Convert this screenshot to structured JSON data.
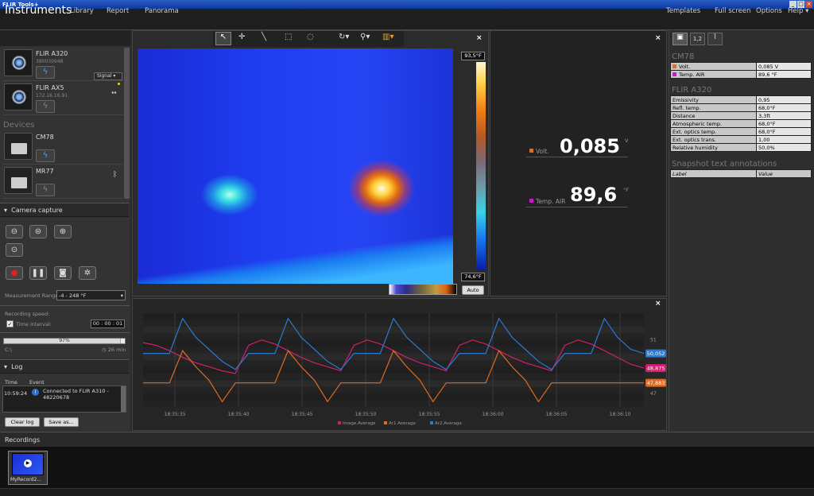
{
  "titlebar": {
    "title": "FLIR Tools+"
  },
  "menubar": {
    "app_name": "Instruments",
    "items": [
      "Library",
      "Report",
      "Panorama"
    ],
    "right_items": [
      "Templates",
      "Full screen",
      "Options",
      "Help ▾"
    ]
  },
  "cameras": [
    {
      "name": "FLIR A320",
      "id": "380030948",
      "mode": "Signal",
      "status": "connected"
    },
    {
      "name": "FLIR AX5",
      "id": "172.16.16.91",
      "status": "disconnected"
    }
  ],
  "devices": {
    "heading": "Devices",
    "items": [
      {
        "name": "CM78",
        "status": "connected"
      },
      {
        "name": "MR77",
        "status": "disconnected"
      }
    ]
  },
  "capture": {
    "heading": "Camera capture",
    "range_label": "Measurement Range:",
    "range_value": "-4 - 248 °F",
    "speed_heading": "Recording speed:",
    "interval_label": "Time interval:",
    "interval_value": "00 : 00 : 01",
    "progress": 0.97,
    "progress_label": "97%",
    "drive": "C:\\",
    "time_left": "26 min"
  },
  "log": {
    "heading": "Log",
    "col_time": "Time",
    "col_event": "Event",
    "entries": [
      {
        "time": "10:59:24",
        "event": "Connected to FLIR A310 - 48220678"
      }
    ],
    "clear_btn": "Clear log",
    "save_btn": "Save as..."
  },
  "image": {
    "max_temp": "93,5°F",
    "min_temp": "74,6°F",
    "auto_btn": "Auto"
  },
  "values": [
    {
      "name": "Volt.",
      "value": "0,085",
      "unit": "V",
      "color": "#e07020"
    },
    {
      "name": "Temp. AIR",
      "value": "89,6",
      "unit": "°F",
      "color": "#c020c0"
    }
  ],
  "props": {
    "cm78_heading": "CM78",
    "cm78_rows": [
      {
        "label": "Volt.",
        "value": "0,085  V",
        "color": "#e07020"
      },
      {
        "label": "Temp. AIR",
        "value": "89,6  °F",
        "color": "#c020c0"
      }
    ],
    "a320_heading": "FLIR A320",
    "a320_rows": [
      {
        "label": "Emissivity",
        "value": "0,95"
      },
      {
        "label": "Refl. temp.",
        "value": "68,0°F"
      },
      {
        "label": "Distance",
        "value": "3,3ft"
      },
      {
        "label": "Atmospheric temp.",
        "value": "68,0°F"
      },
      {
        "label": "Ext. optics temp.",
        "value": "68,0°F"
      },
      {
        "label": "Ext. optics trans.",
        "value": "1,00"
      },
      {
        "label": "Relative humidity",
        "value": "50,0%"
      }
    ],
    "snapshot_heading": "Snapshot text annotations",
    "snapshot_cols": {
      "label": "Label",
      "value": "Value"
    }
  },
  "chart_data": {
    "type": "line",
    "x_ticks": [
      "18:35:35",
      "18:35:40",
      "18:35:45",
      "18:35:50",
      "18:35:55",
      "18:36:00",
      "18:36:05",
      "18:36:10"
    ],
    "y_ticks": [
      "51",
      "47"
    ],
    "y_range": [
      46,
      53
    ],
    "series": [
      {
        "name": "Image.Average",
        "color": "#d0206e",
        "current_value": "48,875",
        "values": [
          50.8,
          50.6,
          50.2,
          49.7,
          49.3,
          49.0,
          48.7,
          48.5,
          50.6,
          51.0,
          50.7,
          50.2,
          49.7,
          49.3,
          49.0,
          48.7,
          50.6,
          51.0,
          50.7,
          50.2,
          49.7,
          49.3,
          49.0,
          48.7,
          50.6,
          51.0,
          50.7,
          50.2,
          49.7,
          49.3,
          49.0,
          48.7,
          50.6,
          51.0,
          50.7,
          50.2,
          49.7,
          49.2,
          48.9
        ]
      },
      {
        "name": "Ar1.Average",
        "color": "#e06a20",
        "current_value": "47,883",
        "values": [
          47.8,
          47.8,
          47.8,
          50.2,
          49.0,
          48.0,
          46.4,
          47.8,
          47.8,
          47.8,
          47.8,
          50.2,
          49.0,
          48.0,
          46.4,
          47.8,
          47.8,
          47.8,
          47.8,
          50.2,
          49.0,
          48.0,
          46.4,
          47.8,
          47.8,
          47.8,
          47.8,
          50.2,
          49.0,
          48.0,
          46.4,
          47.8,
          47.8,
          47.8,
          47.8,
          47.8,
          47.8,
          47.8,
          47.8
        ]
      },
      {
        "name": "Ar2.Average",
        "color": "#2a7ad0",
        "current_value": "50,052",
        "values": [
          50.0,
          50.0,
          50.0,
          52.6,
          51.2,
          50.3,
          49.4,
          48.8,
          50.0,
          50.0,
          50.0,
          52.6,
          51.2,
          50.3,
          49.4,
          48.8,
          50.0,
          50.0,
          50.0,
          52.6,
          51.2,
          50.3,
          49.4,
          48.8,
          50.0,
          50.0,
          50.0,
          52.6,
          51.2,
          50.3,
          49.4,
          48.8,
          50.0,
          50.0,
          50.0,
          52.6,
          51.2,
          50.3,
          50.0
        ]
      }
    ]
  },
  "recordings": {
    "heading": "Recordings",
    "items": [
      {
        "name": "MyRecord2..."
      }
    ]
  }
}
